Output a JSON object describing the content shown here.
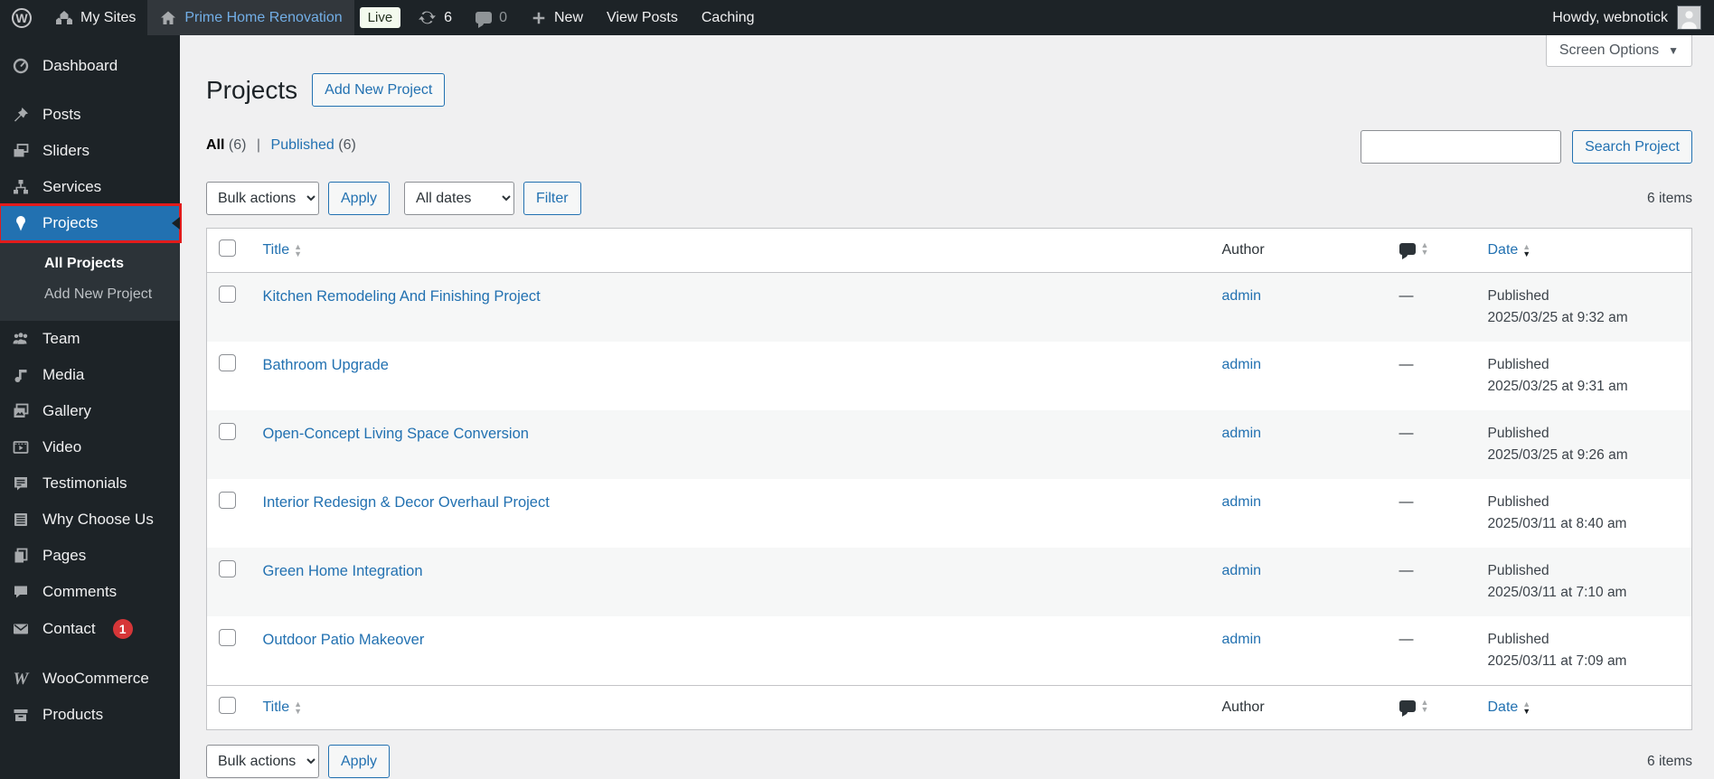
{
  "admin_bar": {
    "my_sites": "My Sites",
    "site_name": "Prime Home Renovation",
    "live_badge": "Live",
    "updates_count": "6",
    "comments_count": "0",
    "new_label": "New",
    "view_posts": "View Posts",
    "caching": "Caching",
    "howdy": "Howdy, webnotick"
  },
  "sidebar": {
    "items": [
      {
        "label": "Dashboard"
      },
      {
        "label": "Posts"
      },
      {
        "label": "Sliders"
      },
      {
        "label": "Services"
      },
      {
        "label": "Projects"
      },
      {
        "label": "Team"
      },
      {
        "label": "Media"
      },
      {
        "label": "Gallery"
      },
      {
        "label": "Video"
      },
      {
        "label": "Testimonials"
      },
      {
        "label": "Why Choose Us"
      },
      {
        "label": "Pages"
      },
      {
        "label": "Comments"
      },
      {
        "label": "Contact",
        "badge": "1"
      },
      {
        "label": "WooCommerce"
      },
      {
        "label": "Products"
      }
    ],
    "submenu": {
      "all_projects": "All Projects",
      "add_new_project": "Add New Project"
    }
  },
  "page": {
    "title": "Projects",
    "add_new_button": "Add New Project",
    "screen_options": "Screen Options",
    "views": {
      "all_label": "All",
      "all_count": "(6)",
      "separator": "|",
      "published_label": "Published",
      "published_count": "(6)"
    },
    "toolbar": {
      "bulk_actions": "Bulk actions",
      "apply": "Apply",
      "all_dates": "All dates",
      "filter": "Filter",
      "search_button": "Search Project",
      "items_count": "6 items"
    },
    "table": {
      "headers": {
        "title": "Title",
        "author": "Author",
        "date": "Date"
      },
      "rows": [
        {
          "title": "Kitchen Remodeling And Finishing Project",
          "author": "admin",
          "comments": "—",
          "status": "Published",
          "date": "2025/03/25 at 9:32 am"
        },
        {
          "title": "Bathroom Upgrade",
          "author": "admin",
          "comments": "—",
          "status": "Published",
          "date": "2025/03/25 at 9:31 am"
        },
        {
          "title": "Open-Concept Living Space Conversion",
          "author": "admin",
          "comments": "—",
          "status": "Published",
          "date": "2025/03/25 at 9:26 am"
        },
        {
          "title": "Interior Redesign & Decor Overhaul Project",
          "author": "admin",
          "comments": "—",
          "status": "Published",
          "date": "2025/03/11 at 8:40 am"
        },
        {
          "title": "Green Home Integration",
          "author": "admin",
          "comments": "—",
          "status": "Published",
          "date": "2025/03/11 at 7:10 am"
        },
        {
          "title": "Outdoor Patio Makeover",
          "author": "admin",
          "comments": "—",
          "status": "Published",
          "date": "2025/03/11 at 7:09 am"
        }
      ]
    }
  },
  "colors": {
    "accent": "#2271b1",
    "admin_bar_bg": "#1d2327",
    "submenu_bg": "#2c3338",
    "badge_red": "#d63638",
    "annotation_red": "#e21b1b",
    "stripe": "#f6f7f7",
    "content_bg": "#f0f0f1",
    "site_link": "#72aee6"
  }
}
